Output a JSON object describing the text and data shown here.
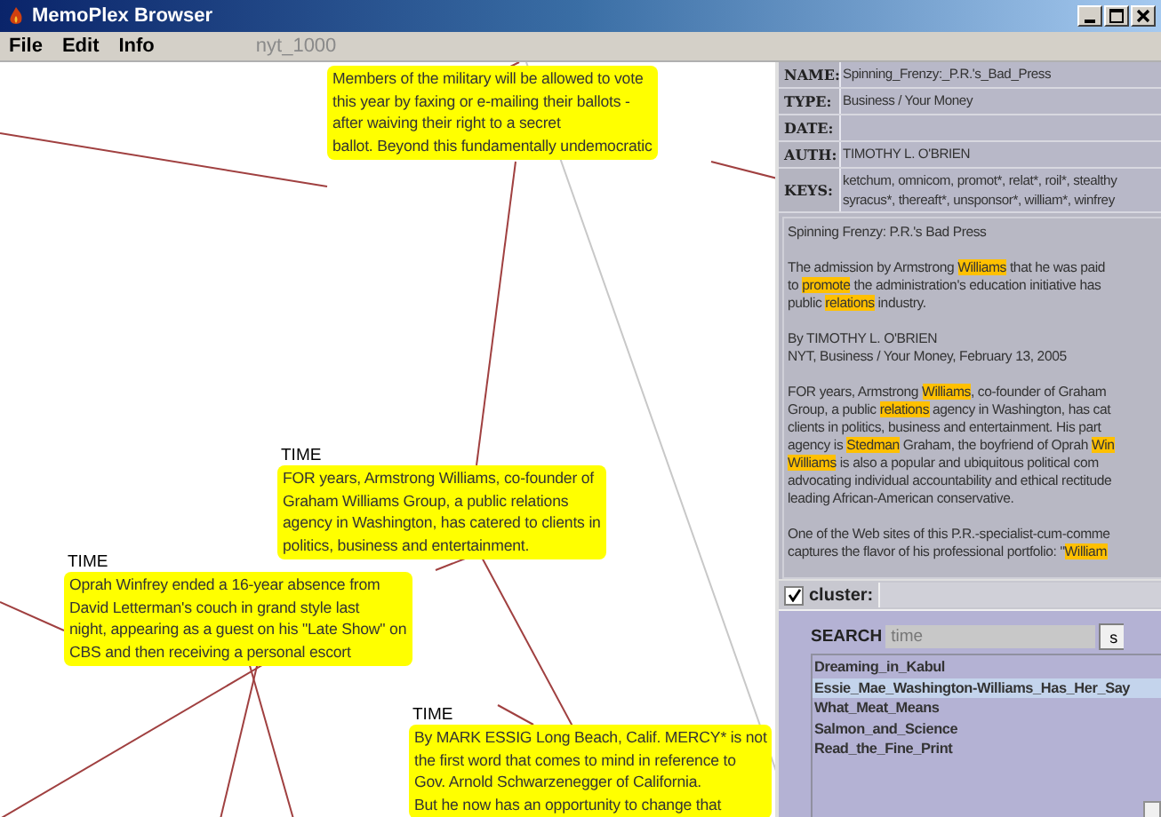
{
  "window": {
    "title": "MemoPlex Browser"
  },
  "menu": [
    "File",
    "Edit",
    "Info"
  ],
  "collection": "nyt_1000",
  "nodes": [
    {
      "lines": [
        "Members of the military will be allowed to vote",
        "this year by faxing or e-mailing their ballots -",
        "after waiving their right to a secret",
        "ballot. Beyond this fundamentally undemocratic"
      ]
    },
    {
      "label": "TIME",
      "lines": [
        "FOR years, Armstrong Williams, co-founder of",
        "Graham Williams Group, a public relations",
        "agency in Washington, has catered to clients in",
        "politics, business and entertainment."
      ]
    },
    {
      "label": "TIME",
      "lines": [
        "Oprah Winfrey ended a 16-year absence from",
        "David Letterman's couch in grand style last",
        "night, appearing as a guest on his \"Late Show\" on",
        "CBS and then receiving a personal escort"
      ]
    },
    {
      "label": "TIME",
      "lines": [
        "By MARK ESSIG Long Beach, Calif. MERCY* is not",
        "the first word that comes to mind in reference to",
        "Gov. Arnold Schwarzenegger of California.",
        "But he now has an opportunity to change that"
      ]
    }
  ],
  "fields": [
    {
      "label": "NAME:",
      "value": [
        "Spinning_Frenzy:_P.R.'s_Bad_Press"
      ]
    },
    {
      "label": "TYPE:",
      "value": [
        "Business / Your Money"
      ]
    },
    {
      "label": "DATE:"
    },
    {
      "label": "AUTH:",
      "value": [
        "TIMOTHY L. O'BRIEN"
      ]
    },
    {
      "label": "KEYS:",
      "value": [
        "ketchum, omnicom, promot*, relat*, roil*, stealthy",
        "syracus*, thereaft*, unsponsor*, william*, winfrey"
      ]
    }
  ],
  "document": [
    [
      [
        {
          "text": "Spinning Frenzy: P.R.'s Bad Press",
          "highlighted": false
        }
      ]
    ],
    [
      [
        {
          "text": "The admission by Armstrong ",
          "highlighted": false
        },
        {
          "text": "Williams",
          "highlighted": true
        },
        {
          "text": " that he was paid",
          "highlighted": false
        }
      ],
      [
        {
          "text": "to ",
          "highlighted": false
        },
        {
          "text": "promote",
          "highlighted": true
        },
        {
          "text": " the administration's education initiative has",
          "highlighted": false
        }
      ],
      [
        {
          "text": "public ",
          "highlighted": false
        },
        {
          "text": "relations",
          "highlighted": true
        },
        {
          "text": " industry.",
          "highlighted": false
        }
      ]
    ],
    [
      [
        {
          "text": "By TIMOTHY L. O'BRIEN",
          "highlighted": false
        }
      ],
      [
        {
          "text": "NYT, Business / Your Money, February 13, 2005",
          "highlighted": false
        }
      ]
    ],
    [
      [
        {
          "text": "FOR years, Armstrong ",
          "highlighted": false
        },
        {
          "text": "Williams",
          "highlighted": true
        },
        {
          "text": ", co-founder of Graham",
          "highlighted": false
        }
      ],
      [
        {
          "text": "Group, a public ",
          "highlighted": false
        },
        {
          "text": "relations",
          "highlighted": true
        },
        {
          "text": " agency in Washington, has cat",
          "highlighted": false
        }
      ],
      [
        {
          "text": "clients in politics, business and entertainment. His part",
          "highlighted": false
        }
      ],
      [
        {
          "text": "agency is ",
          "highlighted": false
        },
        {
          "text": "Stedman",
          "highlighted": true
        },
        {
          "text": " Graham, the boyfriend of Oprah ",
          "highlighted": false
        },
        {
          "text": "Win",
          "highlighted": true
        }
      ],
      [
        {
          "text": "Williams",
          "highlighted": true
        },
        {
          "text": " is also a popular and ubiquitous political com",
          "highlighted": false
        }
      ],
      [
        {
          "text": "advocating individual accountability and ethical rectitude",
          "highlighted": false
        }
      ],
      [
        {
          "text": "leading African-American conservative.",
          "highlighted": false
        }
      ]
    ],
    [
      [
        {
          "text": "One of the Web sites of this P.R.-specialist-cum-comme",
          "highlighted": false
        }
      ],
      [
        {
          "text": "captures the flavor of his professional portfolio: \"",
          "highlighted": false
        },
        {
          "text": "William",
          "highlighted": true
        }
      ]
    ]
  ],
  "cluster": {
    "label": "cluster:",
    "checked": true
  },
  "search": {
    "label": "SEARCH",
    "value": "time",
    "button": "s"
  },
  "results": [
    {
      "title": "Dreaming_in_Kabul",
      "selected": false
    },
    {
      "title": "Essie_Mae_Washington-Williams_Has_Her_Say",
      "selected": true
    },
    {
      "title": "What_Meat_Means",
      "selected": false
    },
    {
      "title": "Salmon_and_Science",
      "selected": false
    },
    {
      "title": "Read_the_Fine_Print",
      "selected": false
    }
  ]
}
